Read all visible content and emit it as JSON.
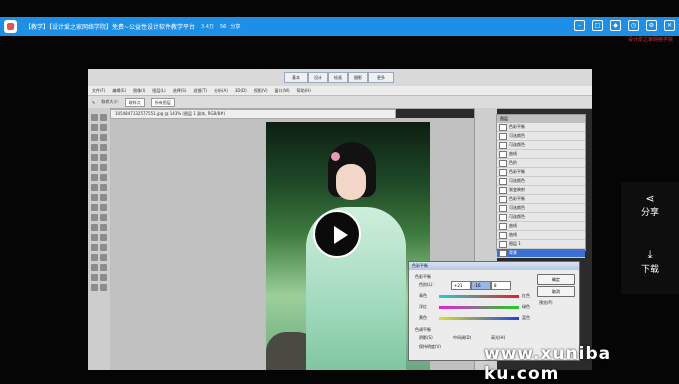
{
  "topbar": {
    "title": "【教学】【设计爱之家网络学院】免费~公益性设计软件教学平台",
    "views": "3.4万",
    "likes": "56",
    "share_label": "分享",
    "icons": [
      "minus-icon",
      "maximize-icon",
      "gamepad-icon",
      "clock-icon",
      "settings-icon",
      "close-icon"
    ]
  },
  "red_link": "设计爱之家网络学院",
  "ps": {
    "menu_items": [
      "文件(F)",
      "编辑(E)",
      "图像(I)",
      "图层(L)",
      "选择(S)",
      "滤镜(T)",
      "分析(A)",
      "3D(D)",
      "视图(V)",
      "窗口(W)",
      "帮助(H)"
    ],
    "tab_buttons": [
      "基本",
      "设计",
      "绘画",
      "摄影",
      "更多"
    ],
    "option_label": "取样大小:",
    "option_value": "取样点",
    "option_value2": "所有图层",
    "doc_tab": "1054847132577551.jpg @ 143% (图层 1 副本, RGB/8#)",
    "layers": [
      "色彩平衡",
      "可选颜色",
      "可选颜色",
      "曲线",
      "色阶",
      "色彩平衡",
      "可选颜色",
      "渐变映射",
      "色彩平衡",
      "可选颜色",
      "可选颜色",
      "曲线",
      "曲线",
      "图层 1",
      "背景"
    ],
    "layers_header": "图层"
  },
  "dialog": {
    "title": "色彩平衡",
    "section_label": "色彩平衡",
    "levels_label": "色阶(L):",
    "levels_values": [
      "+21",
      "-16",
      "8"
    ],
    "slider_rows": [
      {
        "left": "青色",
        "right": "红色",
        "pos": 0.62
      },
      {
        "left": "洋红",
        "right": "绿色",
        "pos": 0.42
      },
      {
        "left": "黄色",
        "right": "蓝色",
        "pos": 0.55
      }
    ],
    "tone_section": "色调平衡",
    "tone_options": [
      "阴影(S)",
      "中间调(D)",
      "高光(H)"
    ],
    "preserve_label": "保持明度(V)",
    "buttons": [
      "确定",
      "取消"
    ],
    "preview_label": "预览(P)"
  },
  "side_buttons": [
    {
      "label": "分享",
      "icon": "share-icon"
    },
    {
      "label": "下载",
      "icon": "download-icon"
    }
  ],
  "watermark": "www.xuniba ku.com"
}
